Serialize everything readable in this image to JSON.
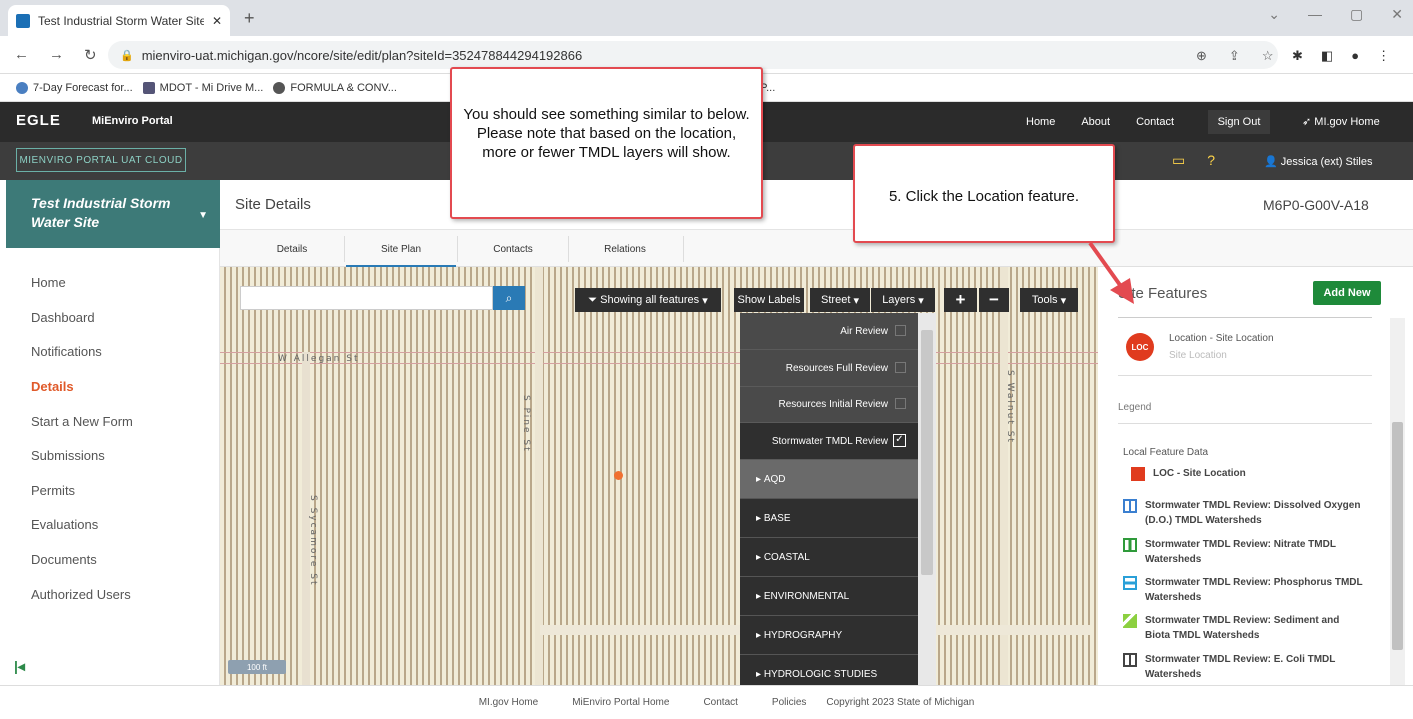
{
  "browser": {
    "tab_title": "Test Industrial Storm Water Site",
    "url": "mienviro-uat.michigan.gov/ncore/site/edit/plan?siteId=352478844294192866",
    "bookmarks": [
      "7-Day Forecast for...",
      "MDOT - Mi Drive M...",
      "FORMULA & CONV...",
      "iro P..."
    ]
  },
  "header": {
    "logo": "EGLE",
    "portal": "MiEnviro Portal",
    "nav": [
      "Home",
      "About",
      "Contact"
    ],
    "sign_out": "Sign Out",
    "migov": "MI.gov Home",
    "uat_badge": "MIENVIRO PORTAL UAT CLOUD",
    "user": "Jessica (ext) Stiles"
  },
  "sidebar": {
    "site_name_line1": "Test Industrial Storm",
    "site_name_line2": "Water Site",
    "items": [
      "Home",
      "Dashboard",
      "Notifications",
      "Details",
      "Start a New Form",
      "Submissions",
      "Permits",
      "Evaluations",
      "Documents",
      "Authorized Users"
    ],
    "active": "Details"
  },
  "main": {
    "title": "Site Details",
    "site_id": "M6P0-G00V-A18",
    "tabs": [
      "Details",
      "Site Plan",
      "Contacts",
      "Relations"
    ],
    "active_tab": "Site Plan"
  },
  "map": {
    "search_placeholder": "",
    "showing": "Showing all features",
    "show_labels": "Show Labels",
    "street": "Street",
    "layers": "Layers",
    "tools": "Tools",
    "scale": "100 ft",
    "streets": [
      "W Allegan St",
      "S Pine St",
      "S Sycamore St",
      "S Walnut St"
    ],
    "layer_items": [
      {
        "label": "Air Review",
        "checked": false
      },
      {
        "label": "Resources Full Review",
        "checked": false
      },
      {
        "label": "Resources Initial Review",
        "checked": false
      },
      {
        "label": "Stormwater TMDL Review",
        "checked": true
      }
    ],
    "groups": [
      "AQD",
      "BASE",
      "COASTAL",
      "ENVIRONMENTAL",
      "HYDROGRAPHY",
      "HYDROLOGIC STUDIES"
    ]
  },
  "site_features": {
    "title": "Site Features",
    "add_new": "Add New",
    "location_icon": "LOC",
    "location_name": "Location - Site Location",
    "location_sub": "Site Location",
    "legend_title": "Legend",
    "local_feature_data": "Local Feature Data",
    "legend": [
      {
        "label": "LOC - Site Location",
        "color": "#e03b1e"
      },
      {
        "label": "Stormwater TMDL Review: Dissolved Oxygen (D.O.) TMDL Watersheds",
        "color": "#3a7fd0"
      },
      {
        "label": "Stormwater TMDL Review: Nitrate TMDL Watersheds",
        "color": "#2f9a3a"
      },
      {
        "label": "Stormwater TMDL Review: Phosphorus TMDL Watersheds",
        "color": "#2aa0d8"
      },
      {
        "label": "Stormwater TMDL Review: Sediment and Biota TMDL Watersheds",
        "color": "#8cd040"
      },
      {
        "label": "Stormwater TMDL Review: E. Coli TMDL Watersheds",
        "color": "#444444"
      }
    ]
  },
  "footer": {
    "links": [
      "MI.gov Home",
      "MiEnviro Portal Home",
      "Contact",
      "Policies"
    ],
    "copyright": "Copyright 2023 State of Michigan"
  },
  "callouts": {
    "note": "You should see something similar to below.  Please note that based on the location, more or fewer TMDL layers will show.",
    "step": "5. Click the Location feature."
  }
}
